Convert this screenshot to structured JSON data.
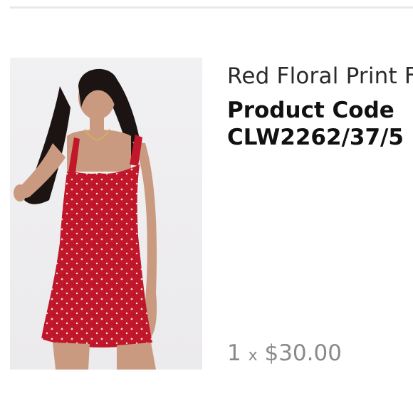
{
  "product": {
    "name": "Red Floral Print F",
    "code_label": "Product Code",
    "code_value": "CLW2262/37/5",
    "quantity": "1",
    "times": "x",
    "price": "$30.00"
  },
  "image": {
    "icon": "product-photo-red-floral-dress",
    "dress_color": "#c0182a",
    "background_color": "#eeedef"
  }
}
